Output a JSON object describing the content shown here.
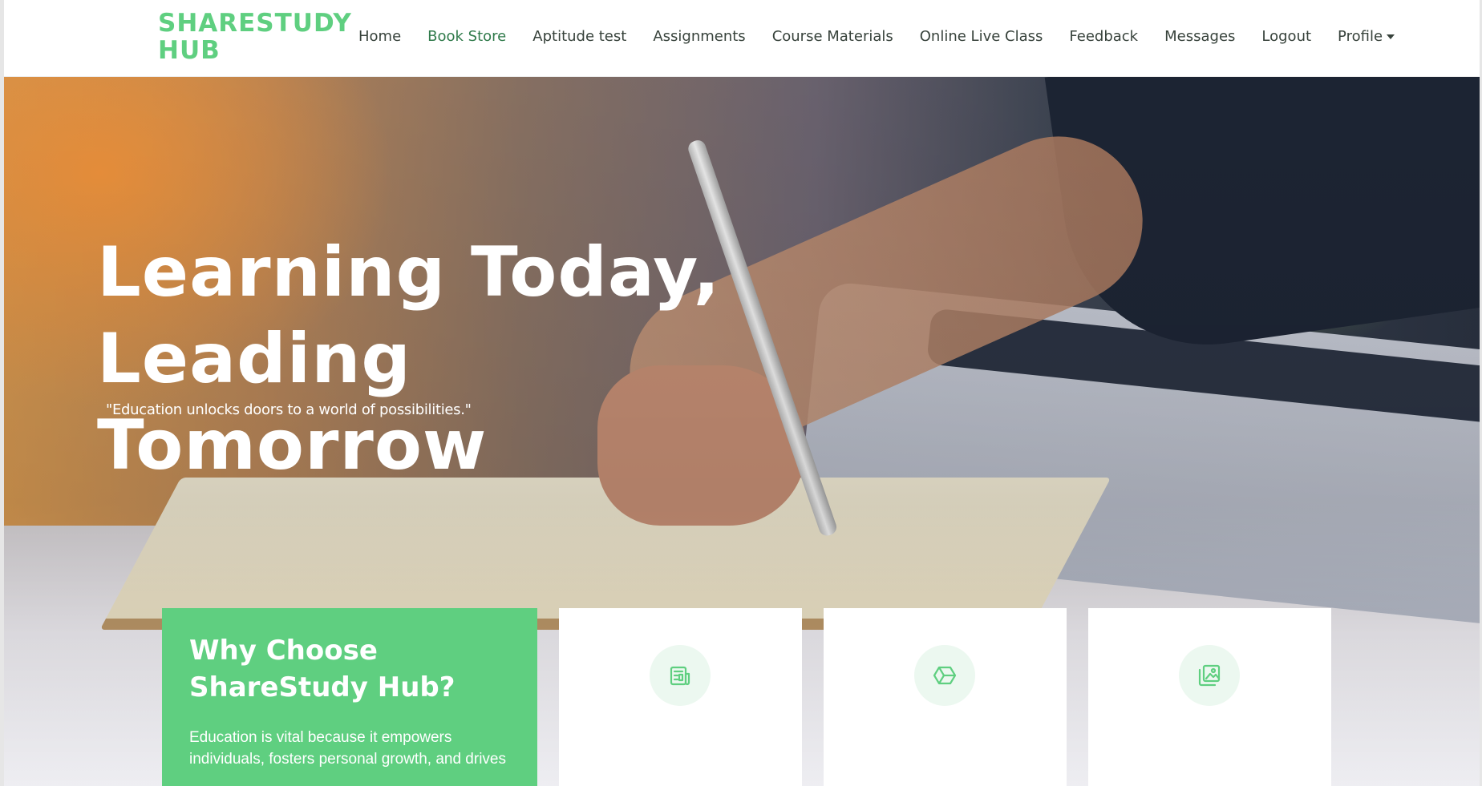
{
  "header": {
    "brand": "SHARESTUDY HUB",
    "nav": [
      {
        "label": "Home",
        "active": false
      },
      {
        "label": "Book Store",
        "active": true
      },
      {
        "label": "Aptitude test",
        "active": false
      },
      {
        "label": "Assignments",
        "active": false
      },
      {
        "label": "Course Materials",
        "active": false
      },
      {
        "label": "Online Live Class",
        "active": false
      },
      {
        "label": "Feedback",
        "active": false
      },
      {
        "label": "Messages",
        "active": false
      },
      {
        "label": "Logout",
        "active": false
      },
      {
        "label": "Profile",
        "active": false,
        "dropdown": true
      }
    ]
  },
  "hero": {
    "title_line1": "Learning Today,",
    "title_line2": "Leading Tomorrow",
    "quote": "\"Education unlocks doors to a world of possibilities.\""
  },
  "why": {
    "title": "Why Choose ShareStudy Hub?",
    "text": "Education is vital because it empowers individuals, fosters personal growth, and drives"
  },
  "icon_cards": [
    {
      "icon": "receipt-icon"
    },
    {
      "icon": "cube-icon"
    },
    {
      "icon": "images-icon"
    }
  ],
  "colors": {
    "accent": "#5fcf80",
    "nav_text": "#37423b",
    "nav_active": "#2f7a4a",
    "icon_bg": "#ecf8f0"
  }
}
